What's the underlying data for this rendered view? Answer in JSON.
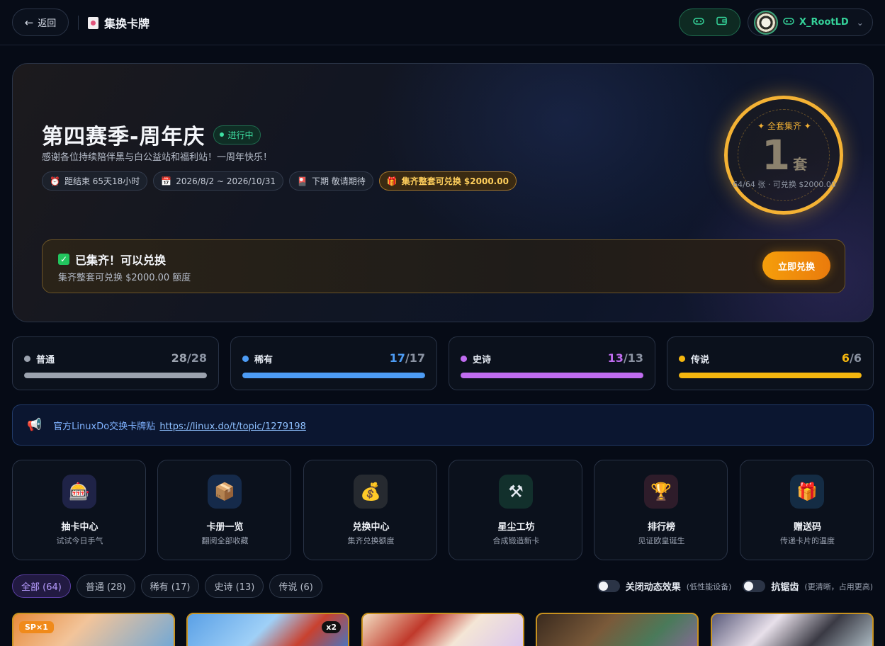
{
  "header": {
    "back_label": "返回",
    "title": "集换卡牌",
    "username": "X_RootLD",
    "icons": [
      "gamepad-icon",
      "wallet-icon",
      "chevron-down-icon"
    ]
  },
  "hero": {
    "season_title": "第四赛季-周年庆",
    "status": "进行中",
    "subtitle": "感谢各位持续陪伴黑与白公益站和福利站！一周年快乐！",
    "chips": [
      {
        "icon": "alarm-clock-icon",
        "text": "距结束 65天18小时"
      },
      {
        "icon": "calendar-icon",
        "text": "2026/8/2 ~ 2026/10/31"
      },
      {
        "icon": "chest-icon",
        "text": "下期 敬请期待"
      },
      {
        "icon": "gift-icon",
        "text": "集齐整套可兑换 $2000.00"
      }
    ],
    "ring": {
      "label": "✦ 全套集齐 ✦",
      "number": "1",
      "unit": "套",
      "footer": "64/64 张 · 可兑换 $2000.00"
    },
    "redeem": {
      "title": "已集齐！可以兑换",
      "subtitle": "集齐整套可兑换 $2000.00 额度",
      "button": "立即兑换"
    }
  },
  "rarities": [
    {
      "name": "普通",
      "have": "28",
      "total": "/28",
      "color": "#9ca3af",
      "progress": 1.0
    },
    {
      "name": "稀有",
      "have": "17",
      "total": "/17",
      "color": "#4d9cf5",
      "progress": 1.0
    },
    {
      "name": "史诗",
      "have": "13",
      "total": "/13",
      "color": "#c06cf0",
      "progress": 1.0
    },
    {
      "name": "传说",
      "have": "6",
      "total": "/6",
      "color": "#f5b70f",
      "progress": 1.0
    }
  ],
  "notice": {
    "text": "官方LinuxDo交换卡牌贴",
    "link": "https://linux.do/t/topic/1279198"
  },
  "features": [
    {
      "title": "抽卡中心",
      "subtitle": "试试今日手气",
      "icon": "slot-machine-icon",
      "bg": "#1f2347"
    },
    {
      "title": "卡册一览",
      "subtitle": "翻阅全部收藏",
      "icon": "package-icon",
      "bg": "#152a4a"
    },
    {
      "title": "兑换中心",
      "subtitle": "集齐兑换额度",
      "icon": "money-bag-icon",
      "bg": "#262a30"
    },
    {
      "title": "星尘工坊",
      "subtitle": "合成锻造新卡",
      "icon": "hammer-pick-icon",
      "bg": "#12302c"
    },
    {
      "title": "排行榜",
      "subtitle": "见证欧皇诞生",
      "icon": "trophy-icon",
      "bg": "#2e1c2a"
    },
    {
      "title": "赠送码",
      "subtitle": "传递卡片的温度",
      "icon": "gift-icon",
      "bg": "#142c44"
    }
  ],
  "filters": [
    "全部 (64)",
    "普通 (28)",
    "稀有 (17)",
    "史诗 (13)",
    "传说 (6)"
  ],
  "toggles": [
    {
      "label": "关闭动态效果",
      "hint": "(低性能设备)"
    },
    {
      "label": "抗锯齿",
      "hint": "(更清晰，占用更高)"
    }
  ],
  "cards": [
    {
      "tag": "SP×1",
      "mult": ""
    },
    {
      "tag": "",
      "mult": "x2"
    },
    {
      "tag": "",
      "mult": ""
    },
    {
      "tag": "",
      "mult": ""
    },
    {
      "tag": "",
      "mult": ""
    }
  ]
}
